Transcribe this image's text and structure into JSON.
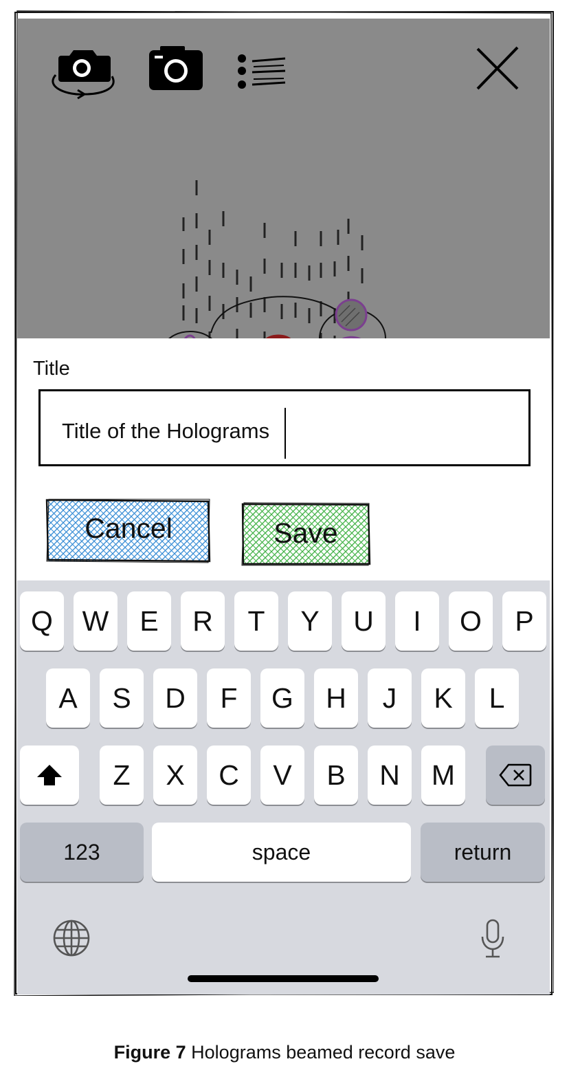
{
  "toolbar": {
    "icons": [
      "camera-switch-icon",
      "camera-icon",
      "list-icon",
      "close-icon"
    ]
  },
  "form": {
    "title_label": "Title",
    "title_value": "Title of the Holograms",
    "cancel_label": "Cancel",
    "save_label": "Save"
  },
  "colors": {
    "camera_bg": "#8a8a8a",
    "cancel": "#3b8fd6",
    "save": "#45b34a",
    "keyboard_bg": "#d7d9df",
    "hologram_accent": "#7b3f8f",
    "hologram_red": "#8b1a1a"
  },
  "keyboard": {
    "row1": [
      "Q",
      "W",
      "E",
      "R",
      "T",
      "Y",
      "U",
      "I",
      "O",
      "P"
    ],
    "row2": [
      "A",
      "S",
      "D",
      "F",
      "G",
      "H",
      "J",
      "K",
      "L"
    ],
    "row3": [
      "Z",
      "X",
      "C",
      "V",
      "B",
      "N",
      "M"
    ],
    "numbers_label": "123",
    "space_label": "space",
    "return_label": "return",
    "icons": [
      "shift-icon",
      "backspace-icon",
      "globe-icon",
      "microphone-icon"
    ]
  },
  "caption": {
    "label": "Figure 7",
    "text": "Holograms beamed record save"
  }
}
